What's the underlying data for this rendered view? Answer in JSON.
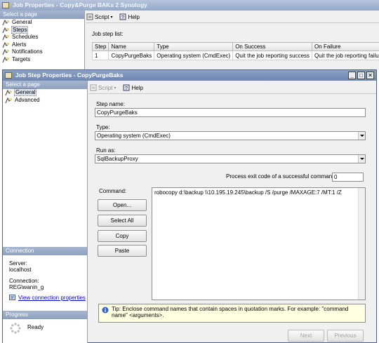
{
  "back_window": {
    "title": "Job Properties - Copy&Purge BAKs 2 Synology",
    "select_page_header": "Select a page",
    "nav_items": [
      "General",
      "Steps",
      "Schedules",
      "Alerts",
      "Notifications",
      "Targets"
    ],
    "selected_nav": "Steps",
    "toolbar": {
      "script_label": "Script",
      "help_label": "Help"
    },
    "job_step_list_label": "Job step list:",
    "table": {
      "columns": [
        "Step",
        "Name",
        "Type",
        "On Success",
        "On Failure"
      ],
      "rows": [
        [
          "1",
          "CopyPurgeBaks",
          "Operating system (CmdExec)",
          "Quit the job reporting success",
          "Quit the job reporting failure"
        ]
      ]
    }
  },
  "dialog": {
    "title": "Job Step Properties - CopyPurgeBaks",
    "select_page_header": "Select a page",
    "nav_items": [
      "General",
      "Advanced"
    ],
    "selected_nav": "General",
    "toolbar": {
      "script_label": "Script",
      "help_label": "Help"
    },
    "step_name_label": "Step name:",
    "step_name_value": "CopyPurgeBaks",
    "type_label": "Type:",
    "type_value": "Operating system (CmdExec)",
    "run_as_label": "Run as:",
    "run_as_value": "SqlBackupProxy",
    "exit_code_label": "Process exit code of a successful command:",
    "exit_code_value": "0",
    "command_label": "Command:",
    "buttons": {
      "open": "Open...",
      "select_all": "Select All",
      "copy": "Copy",
      "paste": "Paste"
    },
    "command_text": "robocopy d:\\backup \\\\10.195.19.245\\backup /S /purge /MAXAGE:7 /MT:1 /Z",
    "tip_text": "Tip: Enclose command names that contain spaces in quotation marks. For example: \"command name\" <arguments>.",
    "nav_buttons": {
      "next": "Next",
      "previous": "Previous"
    },
    "connection": {
      "header": "Connection",
      "server_label": "Server:",
      "server_value": "localhost",
      "connection_label": "Connection:",
      "connection_value": "REG\\wanin_g",
      "view_link": "View connection properties"
    },
    "progress": {
      "header": "Progress",
      "status": "Ready"
    }
  },
  "colors": {
    "title_active": "#6f87b1",
    "section_header": "#8c9fc0",
    "link": "#0000cc",
    "tip_bg": "#ffffe1"
  }
}
